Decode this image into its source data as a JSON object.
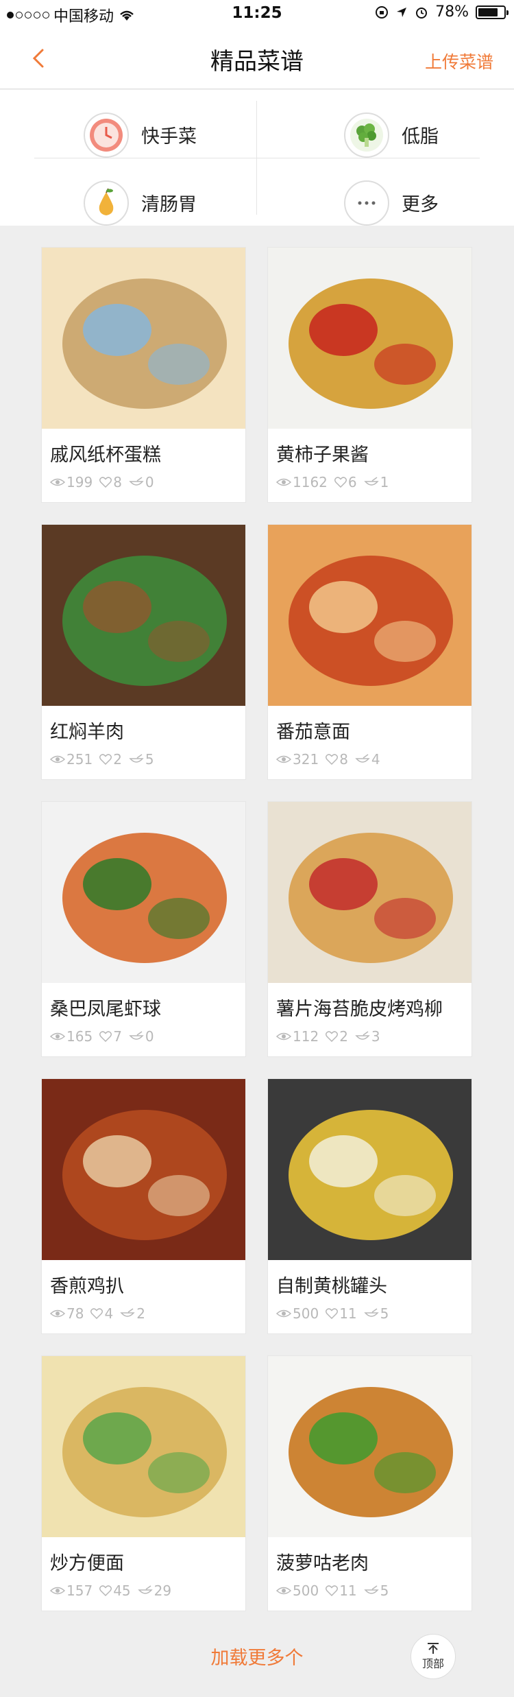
{
  "status_bar": {
    "carrier": "中国移动",
    "time": "11:25",
    "battery": "78%",
    "battery_level": 0.78
  },
  "nav": {
    "title": "精品菜谱",
    "upload_label": "上传菜谱"
  },
  "categories": [
    {
      "label": "快手菜",
      "icon": "clock-icon"
    },
    {
      "label": "低脂",
      "icon": "broccoli-icon"
    },
    {
      "label": "清肠胃",
      "icon": "pear-icon"
    },
    {
      "label": "更多",
      "icon": "more-icon"
    }
  ],
  "recipes": [
    {
      "name": "戚风纸杯蛋糕",
      "views": "199",
      "likes": "8",
      "comments": "0",
      "photo_colors": [
        "#f4e3c0",
        "#c9a36a",
        "#87b6d9"
      ]
    },
    {
      "name": "黄柿子果酱",
      "views": "1162",
      "likes": "6",
      "comments": "1",
      "photo_colors": [
        "#f2f2ef",
        "#d39a2a",
        "#c7241d"
      ]
    },
    {
      "name": "红焖羊肉",
      "views": "251",
      "likes": "2",
      "comments": "5",
      "photo_colors": [
        "#5b3a24",
        "#3e8a3a",
        "#8c5a2f"
      ]
    },
    {
      "name": "番茄意面",
      "views": "321",
      "likes": "8",
      "comments": "4",
      "photo_colors": [
        "#e8a25a",
        "#c9471f",
        "#f1c48a"
      ]
    },
    {
      "name": "桑巴凤尾虾球",
      "views": "165",
      "likes": "7",
      "comments": "0",
      "photo_colors": [
        "#f2f2f2",
        "#d86a2d",
        "#2f7a2a"
      ]
    },
    {
      "name": "薯片海苔脆皮烤鸡柳",
      "views": "112",
      "likes": "2",
      "comments": "3",
      "photo_colors": [
        "#e9e1d2",
        "#d9a04d",
        "#c22b2b"
      ]
    },
    {
      "name": "香煎鸡扒",
      "views": "78",
      "likes": "4",
      "comments": "2",
      "photo_colors": [
        "#7a2a17",
        "#b44a1f",
        "#e8c9a0"
      ]
    },
    {
      "name": "自制黄桃罐头",
      "views": "500",
      "likes": "11",
      "comments": "5",
      "photo_colors": [
        "#3a3a3a",
        "#e8c23a",
        "#f2eed8"
      ]
    },
    {
      "name": "炒方便面",
      "views": "157",
      "likes": "45",
      "comments": "29",
      "photo_colors": [
        "#f0e2b0",
        "#d7b25a",
        "#5aa64a"
      ]
    },
    {
      "name": "菠萝咕老肉",
      "views": "500",
      "likes": "11",
      "comments": "5",
      "photo_colors": [
        "#f4f4f2",
        "#c9781f",
        "#3f9a2f"
      ]
    }
  ],
  "footer": {
    "load_more": "加载更多个",
    "top_label": "顶部"
  },
  "colors": {
    "accent": "#f07a38",
    "muted": "#b8b8b8"
  }
}
